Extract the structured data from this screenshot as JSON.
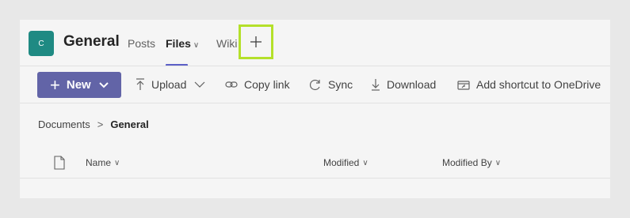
{
  "header": {
    "team_initial": "C",
    "channel_name": "General",
    "tabs": [
      {
        "label": "Posts"
      },
      {
        "label": "Files",
        "active": true
      },
      {
        "label": "Wiki"
      }
    ],
    "add_tab_icon": "plus-icon"
  },
  "toolbar": {
    "new_label": "New",
    "upload_label": "Upload",
    "copy_link_label": "Copy link",
    "sync_label": "Sync",
    "download_label": "Download",
    "add_shortcut_label": "Add shortcut to OneDrive"
  },
  "breadcrumb": {
    "root": "Documents",
    "current": "General"
  },
  "table": {
    "columns": [
      "Name",
      "Modified",
      "Modified By"
    ]
  },
  "colors": {
    "accent": "#6264a7",
    "team_avatar": "#1f8a83",
    "highlight": "#b4e02a"
  }
}
